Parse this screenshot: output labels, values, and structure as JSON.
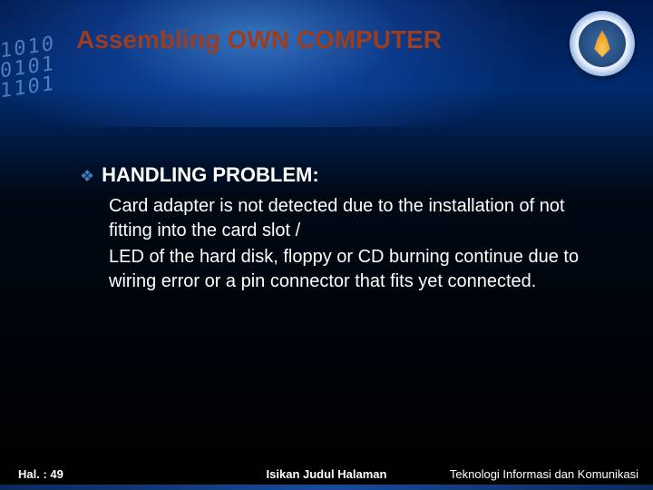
{
  "title": "Assembling OWN COMPUTER",
  "bullet_glyph": "❖",
  "section_heading": "HANDLING PROBLEM:",
  "body1": "Card adapter is not detected due to the installation of not fitting into the card slot /",
  "body2": "LED of the hard disk, floppy or CD burning continue due to wiring error or a pin connector that fits yet connected.",
  "digits": "1010\n0101\n1101",
  "footer": {
    "page_label": "Hal. : 49",
    "center": "Isikan Judul Halaman",
    "right": "Teknologi Informasi dan Komunikasi"
  }
}
